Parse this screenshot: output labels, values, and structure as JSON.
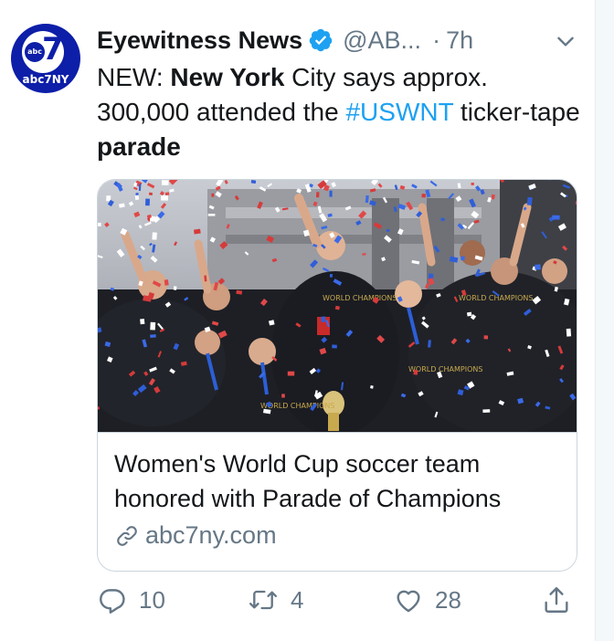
{
  "account": {
    "name": "Eyewitness News",
    "handle": "@AB...",
    "separator": "·",
    "time": "7h",
    "avatar_logo_text": "abc",
    "avatar_seven": "7",
    "avatar_caption": "abc7NY",
    "verified": true
  },
  "tweet": {
    "text_parts": {
      "p1": "NEW: ",
      "p2": "New York",
      "p3": " City says approx. 300,000 attended the ",
      "hashtag": "#USWNT",
      "p4": " ticker-tape ",
      "p5": "parade"
    }
  },
  "card": {
    "title": "Women's World Cup soccer team honored with Parade of Champions",
    "domain": "abc7ny.com",
    "photo_jersey_texts": [
      "WORLD CHAMPIONS",
      "WORLD CHAMPIONS",
      "WORLD CHAMPIONS",
      "WORLD CHAMPIONS"
    ]
  },
  "actions": {
    "reply_count": "10",
    "retweet_count": "4",
    "like_count": "28"
  },
  "colors": {
    "text_primary": "#14171a",
    "text_secondary": "#657786",
    "link": "#1da1f2",
    "verified": "#1da1f2",
    "abc_brand": "#0d1ea8",
    "border": "#ccd6dd"
  },
  "icons": {
    "verified": "verified-badge-icon",
    "caret": "chevron-down-icon",
    "link": "link-icon",
    "reply": "reply-icon",
    "retweet": "retweet-icon",
    "like": "heart-icon",
    "share": "share-icon"
  }
}
